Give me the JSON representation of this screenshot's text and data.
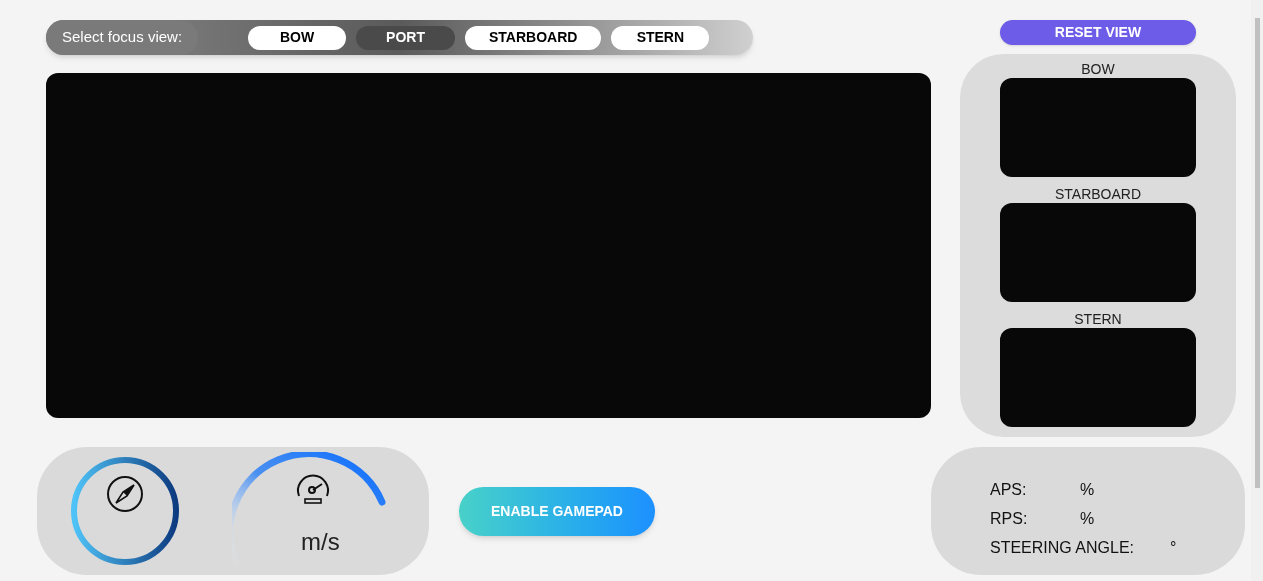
{
  "focus_bar": {
    "label": "Select focus view:",
    "options": [
      {
        "label": "BOW",
        "selected": false
      },
      {
        "label": "PORT",
        "selected": true
      },
      {
        "label": "STARBOARD",
        "selected": false
      },
      {
        "label": "STERN",
        "selected": false
      }
    ]
  },
  "reset_button": "RESET VIEW",
  "side_feeds": [
    {
      "label": "BOW"
    },
    {
      "label": "STARBOARD"
    },
    {
      "label": "STERN"
    }
  ],
  "speed": {
    "unit": "m/s"
  },
  "gamepad_button": "ENABLE GAMEPAD",
  "stats": [
    {
      "label": "APS:",
      "unit": "%"
    },
    {
      "label": "RPS:",
      "unit": "%"
    },
    {
      "label": "STEERING ANGLE:",
      "unit": "°"
    }
  ]
}
